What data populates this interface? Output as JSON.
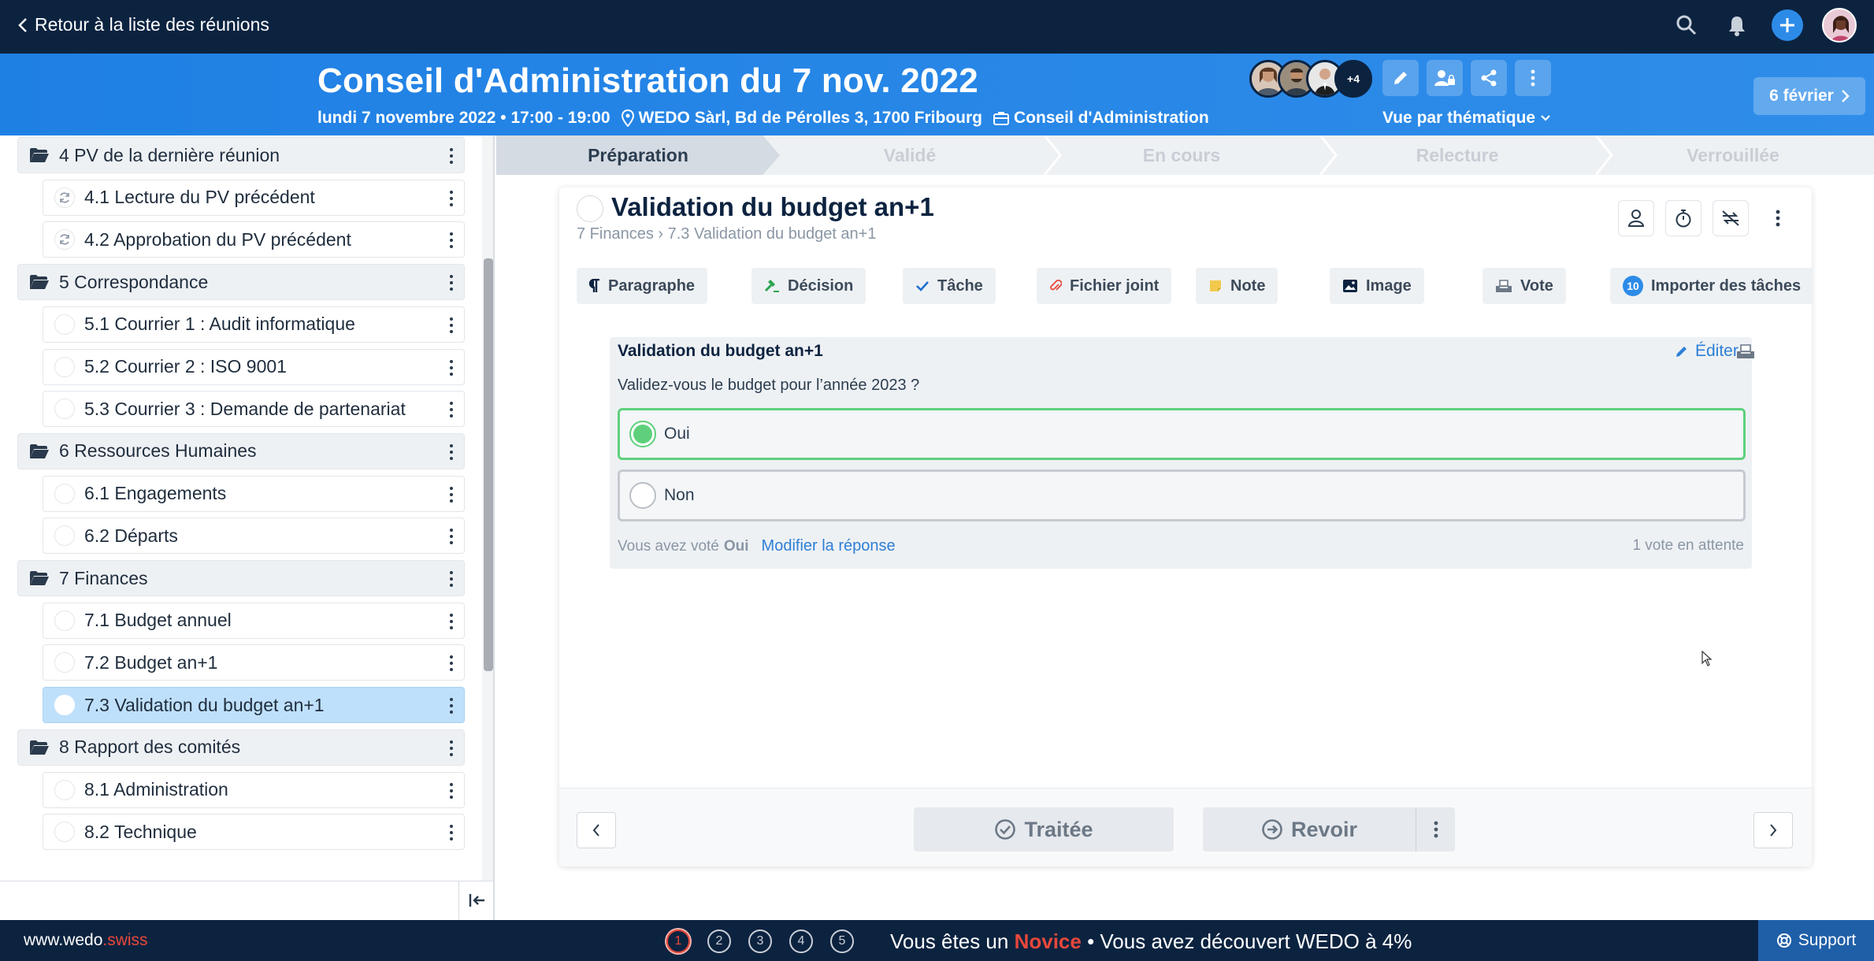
{
  "topbar": {
    "back_label": "Retour à la liste des réunions",
    "icons": [
      "search-icon",
      "bell-icon",
      "plus-icon",
      "user-avatar"
    ]
  },
  "header": {
    "title": "Conseil d'Administration du 7 nov. 2022",
    "datetime": "lundi 7 novembre 2022 • 17:00 - 19:00",
    "location": "WEDO Sàrl, Bd de Pérolles 3, 1700 Fribourg",
    "meeting_type": "Conseil d'Administration",
    "extra_attendees": "+4",
    "view_mode": "Vue par thématique",
    "next_meeting": "6 février"
  },
  "steps": [
    "Préparation",
    "Validé",
    "En cours",
    "Relecture",
    "Verrouillée"
  ],
  "sidebar": {
    "items": [
      {
        "label": "4 PV de la dernière réunion",
        "kind": "folder"
      },
      {
        "label": "4.1 Lecture du PV précédent",
        "kind": "child-recurring"
      },
      {
        "label": "4.2 Approbation du PV précédent",
        "kind": "child-recurring"
      },
      {
        "label": "5 Correspondance",
        "kind": "folder"
      },
      {
        "label": "5.1 Courrier 1 : Audit informatique",
        "kind": "child"
      },
      {
        "label": "5.2 Courrier 2 : ISO 9001",
        "kind": "child"
      },
      {
        "label": "5.3 Courrier 3 : Demande de partenariat",
        "kind": "child"
      },
      {
        "label": "6 Ressources Humaines",
        "kind": "folder"
      },
      {
        "label": "6.1 Engagements",
        "kind": "child"
      },
      {
        "label": "6.2 Départs",
        "kind": "child"
      },
      {
        "label": "7 Finances",
        "kind": "folder"
      },
      {
        "label": "7.1 Budget annuel",
        "kind": "child"
      },
      {
        "label": "7.2 Budget an+1",
        "kind": "child"
      },
      {
        "label": "7.3 Validation du budget an+1",
        "kind": "child-active"
      },
      {
        "label": "8 Rapport des comités",
        "kind": "folder"
      },
      {
        "label": "8.1 Administration",
        "kind": "child"
      },
      {
        "label": "8.2 Technique",
        "kind": "child"
      }
    ]
  },
  "topic": {
    "title": "Validation du budget an+1",
    "breadcrumb_parent": "7 Finances",
    "breadcrumb_current": "7.3 Validation du budget an+1",
    "blocks": [
      "Paragraphe",
      "Décision",
      "Tâche",
      "Fichier joint",
      "Note",
      "Image",
      "Vote",
      "Importer des tâches"
    ],
    "import_count": "10"
  },
  "vote": {
    "title": "Validation du budget an+1",
    "edit_label": "Éditer",
    "question": "Validez-vous le budget pour l’année 2023 ?",
    "options": [
      {
        "label": "Oui",
        "selected": true
      },
      {
        "label": "Non",
        "selected": false
      }
    ],
    "voted_prefix": "Vous avez voté",
    "voted_value": "Oui",
    "modify_label": "Modifier la réponse",
    "pending": "1 vote en attente"
  },
  "footer": {
    "treated_label": "Traitée",
    "review_label": "Revoir"
  },
  "bottombar": {
    "site_prefix": "www.wedo",
    "site_suffix": ".swiss",
    "levels": [
      "1",
      "2",
      "3",
      "4",
      "5"
    ],
    "progress_prefix": "Vous êtes un",
    "level_name": "Novice",
    "progress_suffix": "• Vous avez découvert WEDO à 4%",
    "support_label": "Support"
  },
  "colors": {
    "navy": "#0c2340",
    "blue": "#2d8be8",
    "active_item": "#bfe0fb",
    "vote_green": "#5ed07c",
    "accent_red": "#e8483a"
  }
}
